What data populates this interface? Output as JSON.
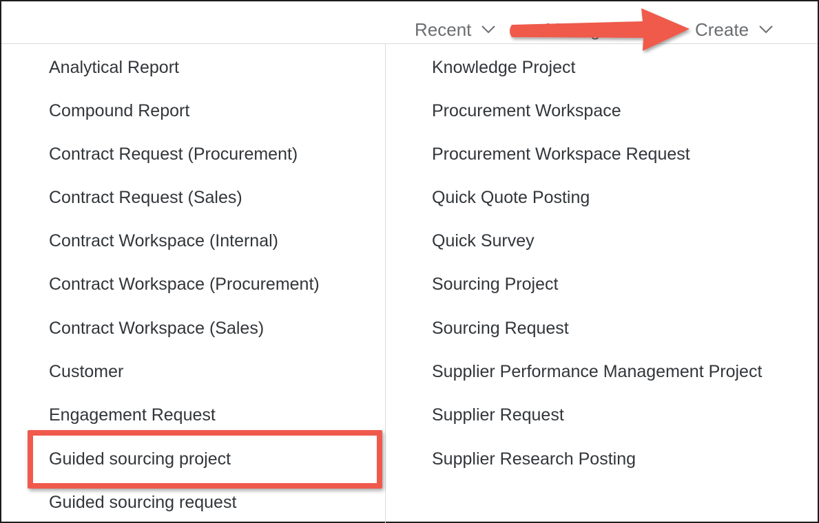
{
  "menubar": {
    "recent_label": "Recent",
    "manage_label": "Manage",
    "create_label": "Create"
  },
  "create_menu": {
    "left_items": [
      "Analytical Report",
      "Compound Report",
      "Contract Request (Procurement)",
      "Contract Request (Sales)",
      "Contract Workspace (Internal)",
      "Contract Workspace (Procurement)",
      "Contract Workspace (Sales)",
      "Customer",
      "Engagement Request",
      "Guided sourcing project",
      "Guided sourcing request"
    ],
    "right_items": [
      "Knowledge Project",
      "Procurement Workspace",
      "Procurement Workspace Request",
      "Quick Quote Posting",
      "Quick Survey",
      "Sourcing Project",
      "Sourcing Request",
      "Supplier Performance Management Project",
      "Supplier Request",
      "Supplier Research Posting"
    ]
  },
  "annotations": {
    "highlight_color": "#ef5a4c",
    "arrow_color": "#ef5a4c"
  }
}
